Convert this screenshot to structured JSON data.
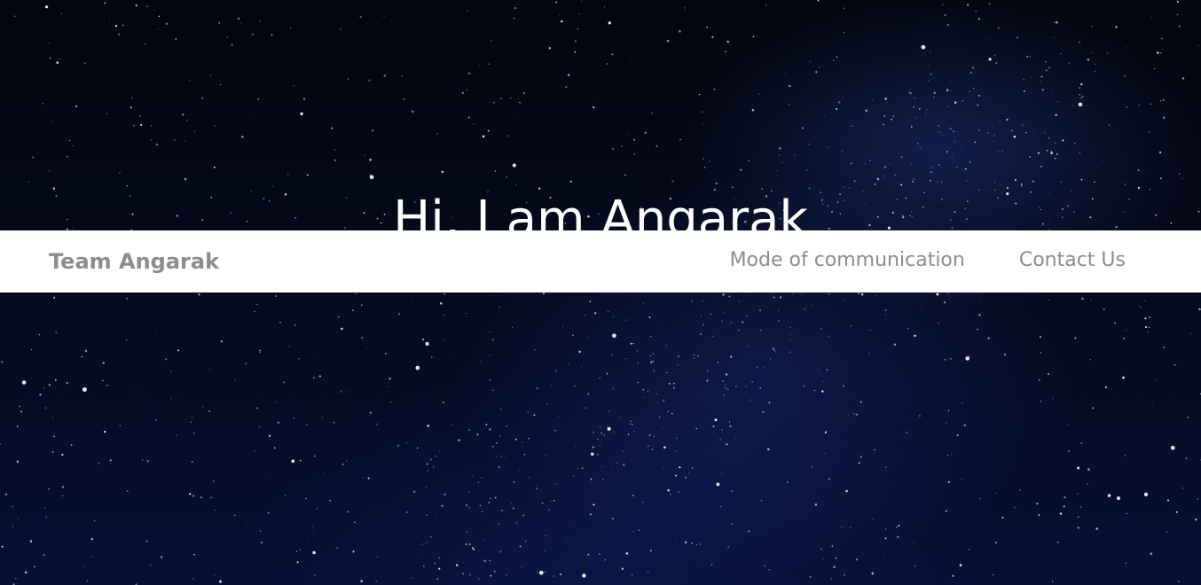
{
  "hero": {
    "title": "Hi, I am Angarak",
    "subtitle": "",
    "background": "starry-night-sky-image"
  },
  "navbar": {
    "brand": "Team Angarak",
    "links": [
      {
        "label": "Mode of communication"
      },
      {
        "label": "Contact Us"
      }
    ]
  },
  "colors": {
    "nav_background": "#ffffff",
    "nav_text": "#8d8d8d",
    "hero_text": "#ffffff",
    "sky": "#04060f",
    "star_tint": "#9fb4ff"
  }
}
